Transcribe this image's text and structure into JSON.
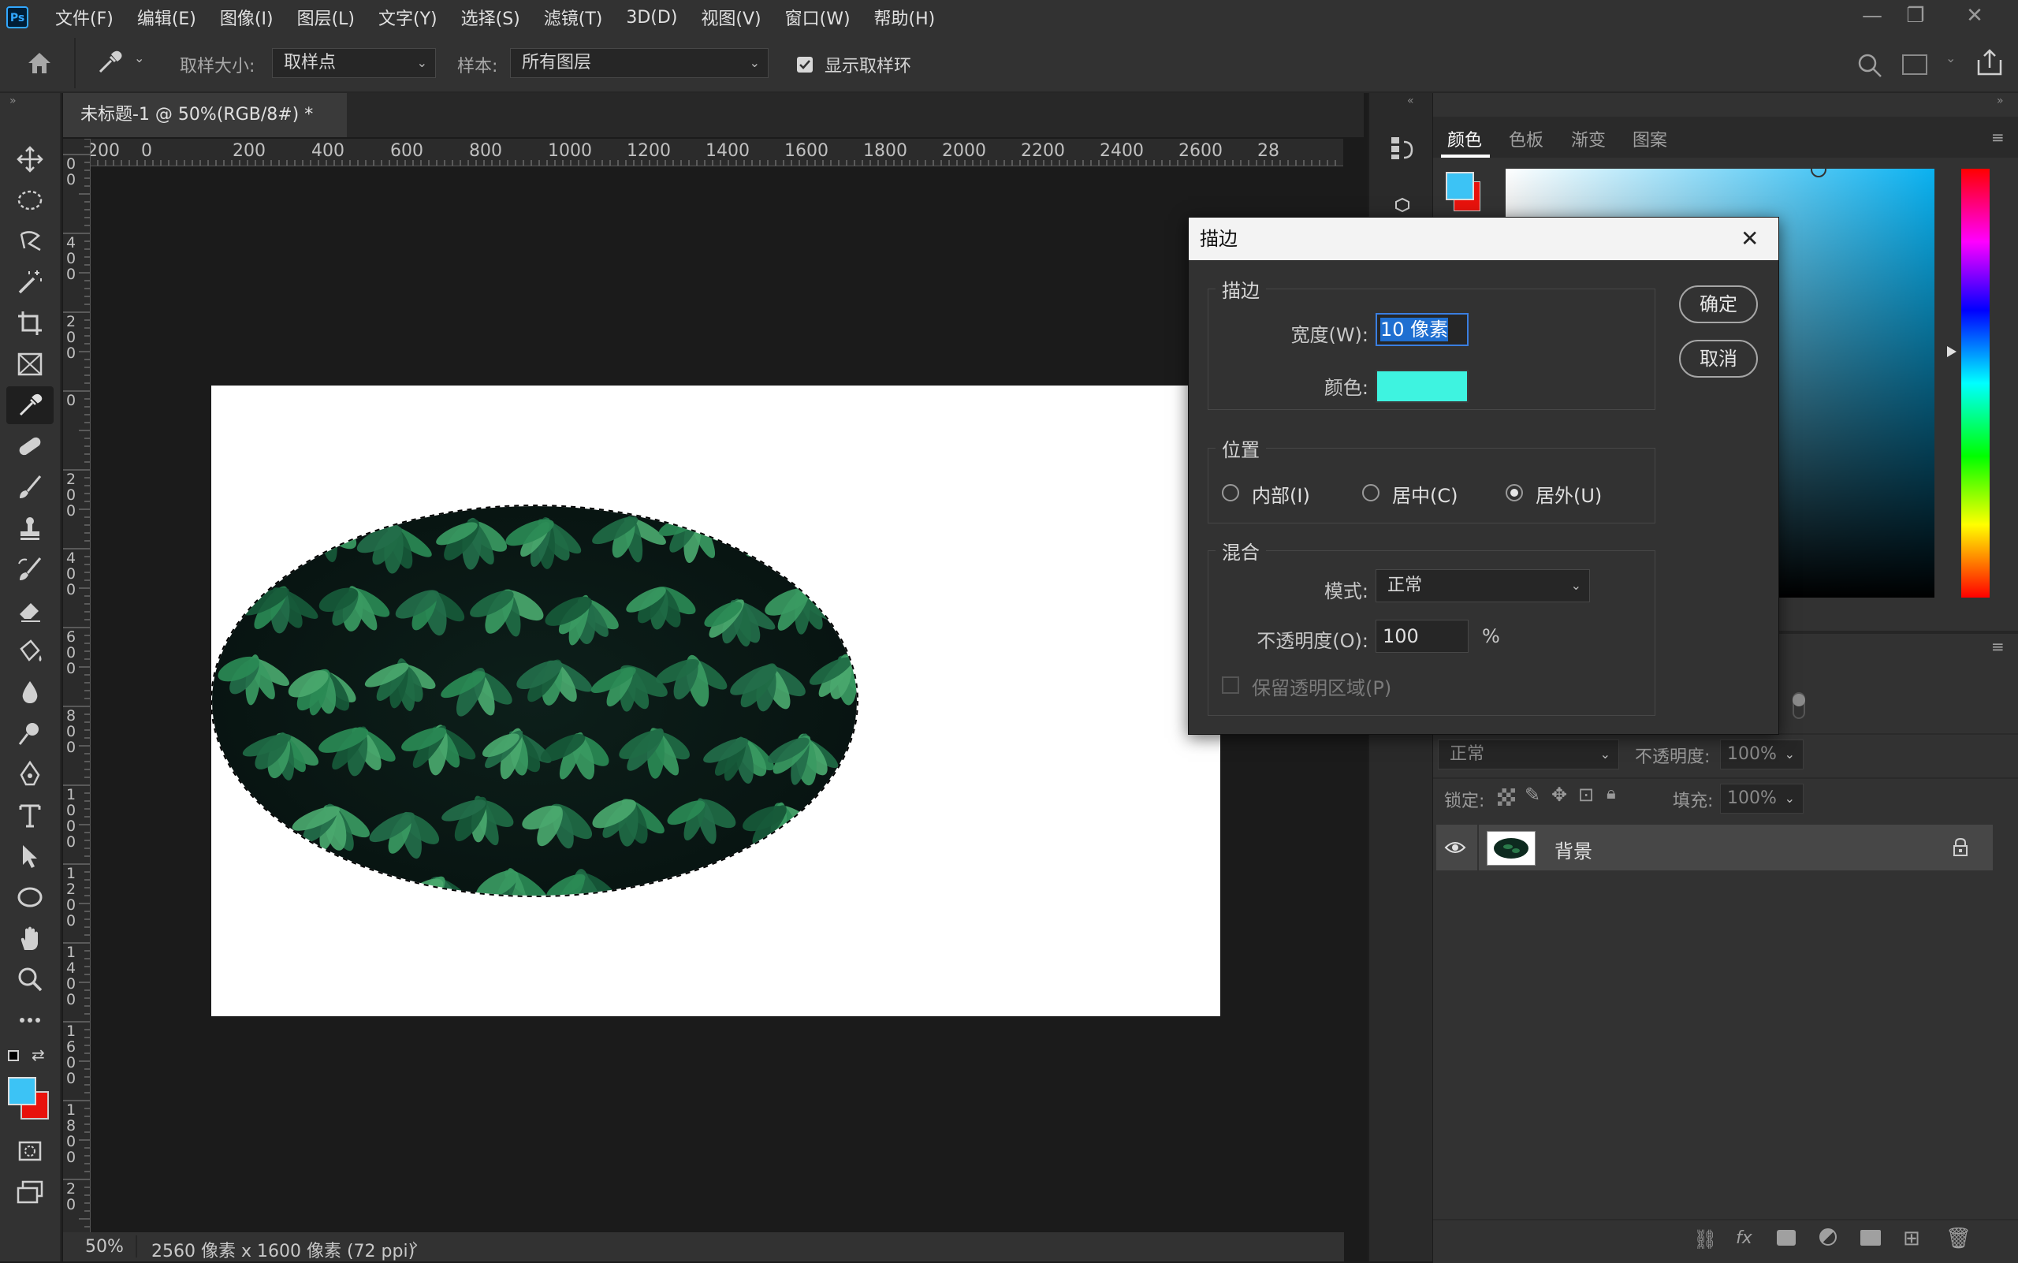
{
  "app": {
    "logo": "Ps"
  },
  "menu": [
    "文件(F)",
    "编辑(E)",
    "图像(I)",
    "图层(L)",
    "文字(Y)",
    "选择(S)",
    "滤镜(T)",
    "3D(D)",
    "视图(V)",
    "窗口(W)",
    "帮助(H)"
  ],
  "options": {
    "sample_size_label": "取样大小:",
    "sample_size_value": "取样点",
    "sample_label": "样本:",
    "sample_value": "所有图层",
    "show_ring_label": "显示取样环",
    "show_ring_checked": true
  },
  "document": {
    "tab_title": "未标题-1 @ 50%(RGB/8#) *",
    "zoom": "50%",
    "size_info": "2560 像素 x 1600 像素 (72 ppi)",
    "hruler_ticks": [
      "200",
      "0",
      "200",
      "400",
      "600",
      "800",
      "1000",
      "1200",
      "1400",
      "1600",
      "1800",
      "2000",
      "2200",
      "2400",
      "2600",
      "28"
    ],
    "vruler_ticks": [
      "0\n0",
      "4\n0\n0",
      "2\n0\n0",
      "0",
      "2\n0\n0",
      "4\n0\n0",
      "6\n0\n0",
      "8\n0\n0",
      "1\n0\n0\n0",
      "1\n2\n0\n0",
      "1\n4\n0\n0",
      "1\n6\n0\n0",
      "1\n8\n0\n0",
      "2\n0"
    ]
  },
  "colors": {
    "foreground": "#3cc3f5",
    "background": "#e8120c",
    "stroke_color": "#3ef3e0"
  },
  "color_panel": {
    "tabs": [
      "颜色",
      "色板",
      "渐变",
      "图案"
    ],
    "active_tab": "颜色"
  },
  "layers_panel": {
    "blend_mode": "正常",
    "opacity_label": "不透明度:",
    "opacity_value": "100%",
    "lock_label": "锁定:",
    "fill_label": "填充:",
    "fill_value": "100%",
    "layers": [
      {
        "name": "背景",
        "visible": true,
        "locked": true
      }
    ]
  },
  "dialog": {
    "title": "描边",
    "stroke_group": "描边",
    "width_label": "宽度(W):",
    "width_value": "10 像素",
    "color_label": "颜色:",
    "ok_label": "确定",
    "cancel_label": "取消",
    "position_group": "位置",
    "positions": [
      {
        "label": "内部(I)",
        "selected": false
      },
      {
        "label": "居中(C)",
        "selected": false
      },
      {
        "label": "居外(U)",
        "selected": true
      }
    ],
    "blend_group": "混合",
    "mode_label": "模式:",
    "mode_value": "正常",
    "opacity_label": "不透明度(O):",
    "opacity_value": "100",
    "opacity_unit": "%",
    "preserve_label": "保留透明区域(P)"
  }
}
